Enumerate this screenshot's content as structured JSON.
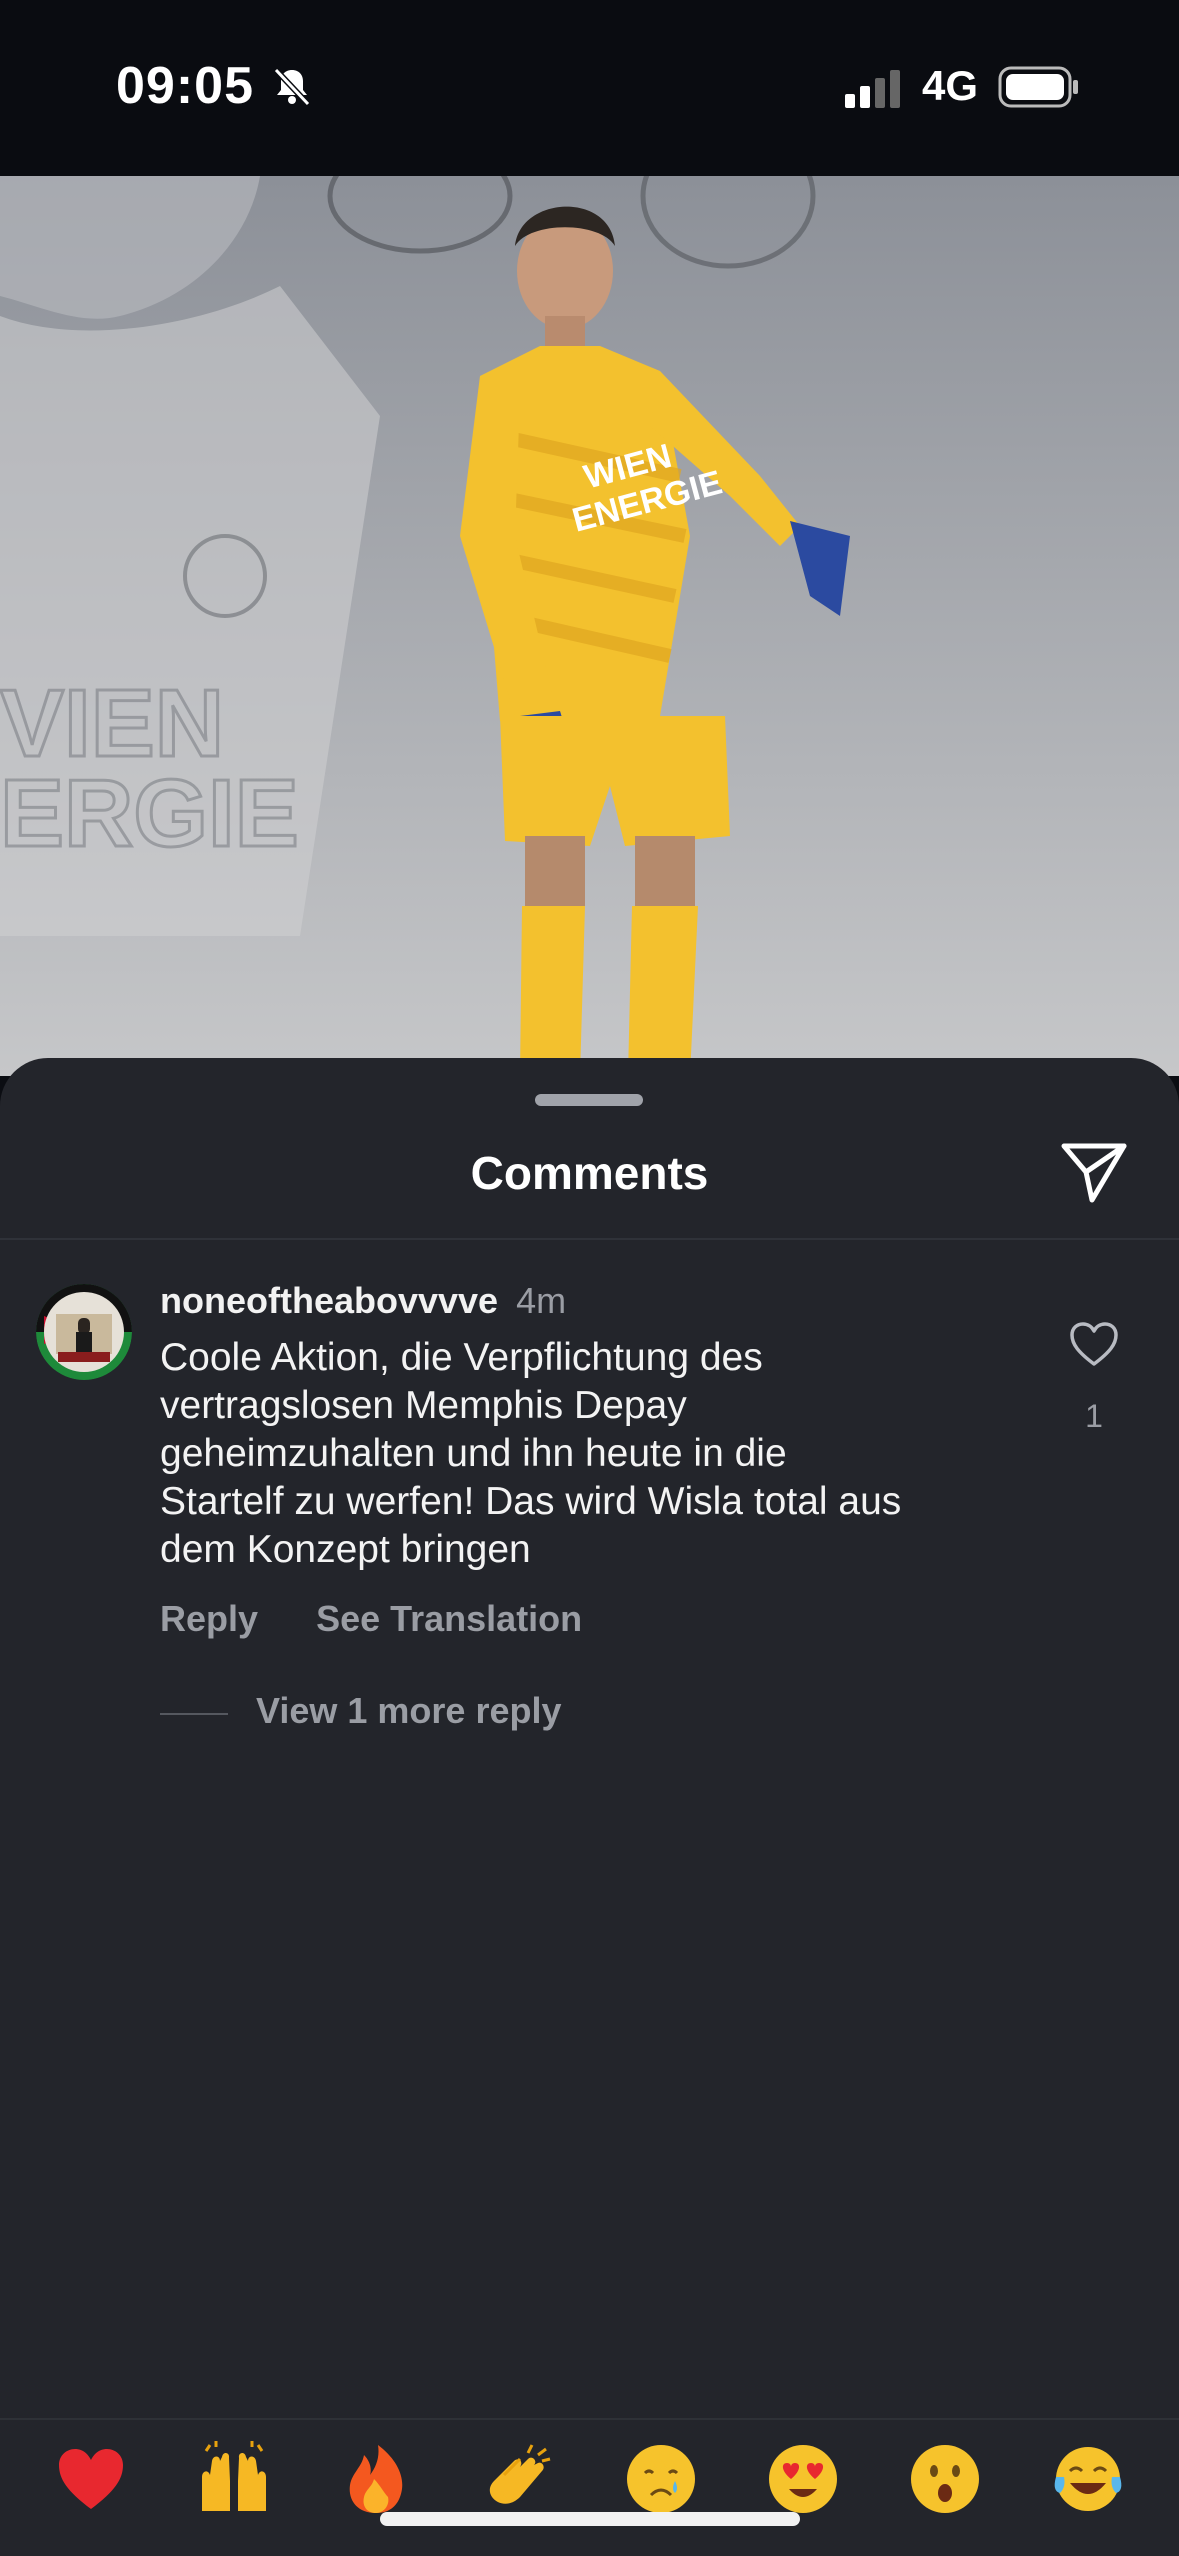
{
  "status_bar": {
    "time": "09:05",
    "network": "4G"
  },
  "post_image": {
    "sponsor_text": "WIEN ENERGIE",
    "jersey_sponsor_line1": "WIEN",
    "jersey_sponsor_line2": "ENERGIE"
  },
  "comments_sheet": {
    "title": "Comments",
    "comments": [
      {
        "username": "noneoftheabovvvve",
        "time": "4m",
        "text": "Coole Aktion, die Verpflichtung des\nvertragslosen Memphis Depay\ngeheimzuhalten und ihn heute in die\nStartelf zu werfen! Das wird Wisla total aus\ndem Konzept bringen",
        "reply_label": "Reply",
        "translate_label": "See Translation",
        "like_count": "1",
        "view_replies_label": "View 1 more reply"
      }
    ]
  },
  "emoji_bar": [
    "heart-emoji",
    "raising-hands-emoji",
    "fire-emoji",
    "clapping-hands-emoji",
    "crying-face-emoji",
    "heart-eyes-emoji",
    "surprised-face-emoji",
    "tears-of-joy-emoji"
  ],
  "colors": {
    "sheet_background": "#23252b",
    "status_bar_background": "#0a0c11",
    "secondary_text": "#9a9da4",
    "jersey_yellow": "#f3c12e"
  }
}
